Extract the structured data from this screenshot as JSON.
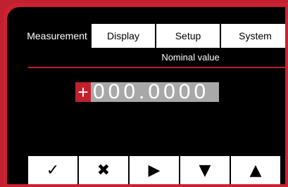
{
  "tabs": [
    {
      "label": "Measurement",
      "active": true
    },
    {
      "label": "Display",
      "active": false
    },
    {
      "label": "Setup",
      "active": false
    },
    {
      "label": "System",
      "active": false
    }
  ],
  "subtitle": "Nominal value",
  "value": {
    "sign": "+",
    "digits": "000.0000"
  },
  "buttons": [
    {
      "symbol": "✓",
      "name": "confirm-button"
    },
    {
      "symbol": "✖",
      "name": "cancel-button"
    },
    {
      "symbol": "▶",
      "name": "right-arrow-button"
    },
    {
      "symbol": "▼",
      "name": "down-arrow-button"
    },
    {
      "symbol": "▲",
      "name": "up-arrow-button"
    }
  ],
  "colors": {
    "accent": "#c1202e",
    "screen": "#000000",
    "value_bg": "#a8a8a8"
  }
}
